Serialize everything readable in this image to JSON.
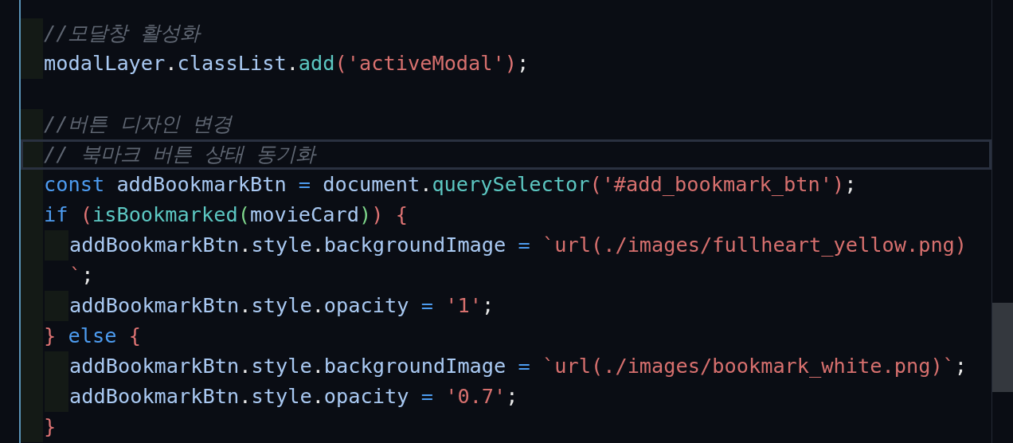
{
  "editor": {
    "lines": [
      {
        "current": false,
        "tokens": [
          {
            "kind": "comment",
            "text": "//모달창 활성화"
          }
        ]
      },
      {
        "current": false,
        "tokens": [
          {
            "kind": "var",
            "text": "modalLayer"
          },
          {
            "kind": "punct",
            "text": "."
          },
          {
            "kind": "var",
            "text": "classList"
          },
          {
            "kind": "punct",
            "text": "."
          },
          {
            "kind": "func",
            "text": "add"
          },
          {
            "kind": "paren",
            "text": "("
          },
          {
            "kind": "string",
            "text": "'activeModal'"
          },
          {
            "kind": "paren",
            "text": ")"
          },
          {
            "kind": "punct",
            "text": ";"
          }
        ]
      },
      {
        "current": false
      },
      {
        "current": false,
        "tokens": [
          {
            "kind": "comment",
            "text": "//버튼 디자인 변경"
          }
        ]
      },
      {
        "current": true,
        "tokens": [
          {
            "kind": "comment",
            "text": "// 북마크 버튼 상태 동기화"
          }
        ]
      },
      {
        "current": false,
        "tokens": [
          {
            "kind": "keyword",
            "text": "const "
          },
          {
            "kind": "var",
            "text": "addBookmarkBtn "
          },
          {
            "kind": "op",
            "text": "= "
          },
          {
            "kind": "var",
            "text": "document"
          },
          {
            "kind": "punct",
            "text": "."
          },
          {
            "kind": "func",
            "text": "querySelector"
          },
          {
            "kind": "paren",
            "text": "("
          },
          {
            "kind": "string",
            "text": "'#add_bookmark_btn'"
          },
          {
            "kind": "paren",
            "text": ")"
          },
          {
            "kind": "punct",
            "text": ";"
          }
        ]
      },
      {
        "current": false,
        "tokens": [
          {
            "kind": "keyword",
            "text": "if "
          },
          {
            "kind": "paren",
            "text": "("
          },
          {
            "kind": "func",
            "text": "isBookmarked"
          },
          {
            "kind": "paren2",
            "text": "("
          },
          {
            "kind": "var",
            "text": "movieCard"
          },
          {
            "kind": "paren2",
            "text": ")"
          },
          {
            "kind": "paren",
            "text": ") {"
          }
        ],
        "children": [
          {
            "current": false,
            "tokens": [
              {
                "kind": "var",
                "text": "addBookmarkBtn"
              },
              {
                "kind": "punct",
                "text": "."
              },
              {
                "kind": "var",
                "text": "style"
              },
              {
                "kind": "punct",
                "text": "."
              },
              {
                "kind": "var",
                "text": "backgroundImage "
              },
              {
                "kind": "op",
                "text": "= "
              },
              {
                "kind": "string",
                "text": "`url(./images/fullheart_yellow.png)"
              }
            ],
            "wrap": [
              {
                "kind": "string",
                "text": "`"
              },
              {
                "kind": "punct",
                "text": ";"
              }
            ]
          },
          {
            "current": false,
            "tokens": [
              {
                "kind": "var",
                "text": "addBookmarkBtn"
              },
              {
                "kind": "punct",
                "text": "."
              },
              {
                "kind": "var",
                "text": "style"
              },
              {
                "kind": "punct",
                "text": "."
              },
              {
                "kind": "var",
                "text": "opacity "
              },
              {
                "kind": "op",
                "text": "= "
              },
              {
                "kind": "string",
                "text": "'1'"
              },
              {
                "kind": "punct",
                "text": ";"
              }
            ]
          }
        ]
      },
      {
        "current": false,
        "tokens": [
          {
            "kind": "paren",
            "text": "} "
          },
          {
            "kind": "keyword",
            "text": "else "
          },
          {
            "kind": "paren",
            "text": "{"
          }
        ],
        "children": [
          {
            "current": false,
            "tokens": [
              {
                "kind": "var",
                "text": "addBookmarkBtn"
              },
              {
                "kind": "punct",
                "text": "."
              },
              {
                "kind": "var",
                "text": "style"
              },
              {
                "kind": "punct",
                "text": "."
              },
              {
                "kind": "var",
                "text": "backgroundImage "
              },
              {
                "kind": "op",
                "text": "= "
              },
              {
                "kind": "string",
                "text": "`url(./images/bookmark_white.png)`"
              },
              {
                "kind": "punct",
                "text": ";"
              }
            ]
          },
          {
            "current": false,
            "tokens": [
              {
                "kind": "var",
                "text": "addBookmarkBtn"
              },
              {
                "kind": "punct",
                "text": "."
              },
              {
                "kind": "var",
                "text": "style"
              },
              {
                "kind": "punct",
                "text": "."
              },
              {
                "kind": "var",
                "text": "opacity "
              },
              {
                "kind": "op",
                "text": "= "
              },
              {
                "kind": "string",
                "text": "'0.7'"
              },
              {
                "kind": "punct",
                "text": ";"
              }
            ]
          }
        ]
      },
      {
        "current": false,
        "tokens": [
          {
            "kind": "paren",
            "text": "}"
          }
        ]
      }
    ]
  }
}
